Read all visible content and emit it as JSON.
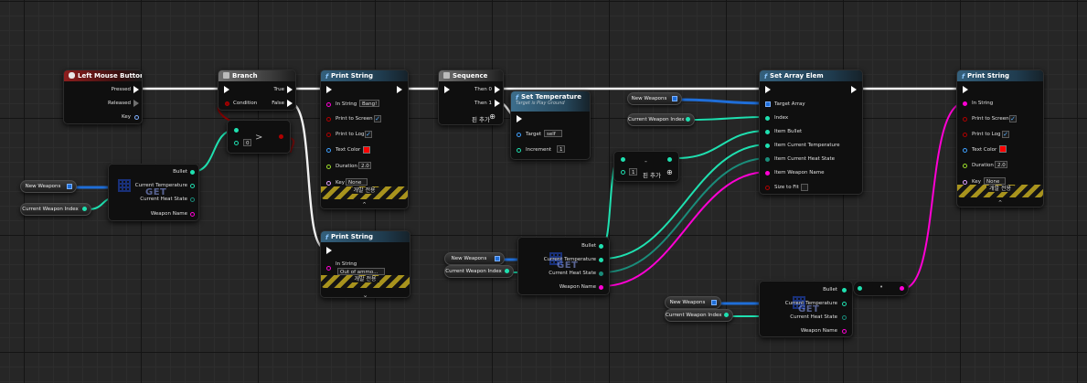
{
  "nodes": {
    "left_mouse_button": {
      "title": "Left Mouse Button",
      "pins": [
        "Pressed",
        "Released",
        "Key"
      ]
    },
    "branch": {
      "title": "Branch",
      "condition": "Condition",
      "true_label": "True",
      "false_label": "False"
    },
    "compare": {
      "op": ">",
      "value": "0"
    },
    "print_string_1": {
      "title": "Print String",
      "in_string_label": "In String",
      "in_string": "Bang!",
      "print_to_screen": "Print to Screen",
      "print_to_log": "Print to Log",
      "text_color": "Text Color",
      "duration_label": "Duration",
      "duration": "2.0",
      "key_label": "Key",
      "key": "None",
      "dev_only": "개발 전용"
    },
    "print_string_2": {
      "title": "Print String",
      "in_string_label": "In String",
      "in_string": "Out of ammo...",
      "dev_only": "개발 전용"
    },
    "sequence": {
      "title": "Sequence",
      "then0": "Then 0",
      "then1": "Then 1",
      "add_pin": "핀 추가"
    },
    "set_temperature": {
      "title": "Set Temperature",
      "subtitle": "Target is Play Ground",
      "target_label": "Target",
      "target": "self",
      "increment_label": "Increment",
      "increment": "1"
    },
    "subtract": {
      "op": "-",
      "value": "1",
      "add_pin": "핀 추가"
    },
    "set_array_elem": {
      "title": "Set Array Elem",
      "target_array": "Target Array",
      "index": "Index",
      "item_bullet": "Item Bullet",
      "item_current_temperature": "Item Current Temperature",
      "item_current_heat_state": "Item Current Heat State",
      "item_weapon_name": "Item Weapon Name",
      "size_to_fit": "Size to Fit"
    },
    "print_string_3": {
      "title": "Print String",
      "in_string_label": "In String",
      "print_to_screen": "Print to Screen",
      "print_to_log": "Print to Log",
      "text_color": "Text Color",
      "duration_label": "Duration",
      "duration": "2.0",
      "key_label": "Key",
      "key": "None",
      "dev_only": "개발 전용"
    },
    "break_struct": {
      "get": "GET",
      "bullet": "Bullet",
      "current_temperature": "Current Temperature",
      "current_heat_state": "Current Heat State",
      "weapon_name": "Weapon Name"
    },
    "variables": {
      "new_weapons": "New Weapons",
      "current_weapon_index": "Current Weapon Index"
    }
  },
  "colors": {
    "background": "#262626",
    "exec": "#ffffff",
    "integer": "#1fe0b0",
    "struct_member": "#1a8c7a",
    "string": "#ff00d4",
    "boolean": "#8b0000",
    "array": "#1f6ed8",
    "text_color_swatch": "#ff0000"
  },
  "icons": [
    "mouse-icon",
    "branch-icon",
    "function-icon",
    "sequence-icon",
    "checkbox-icon",
    "array-icon",
    "add-pin-icon",
    "chevron-down-icon"
  ]
}
